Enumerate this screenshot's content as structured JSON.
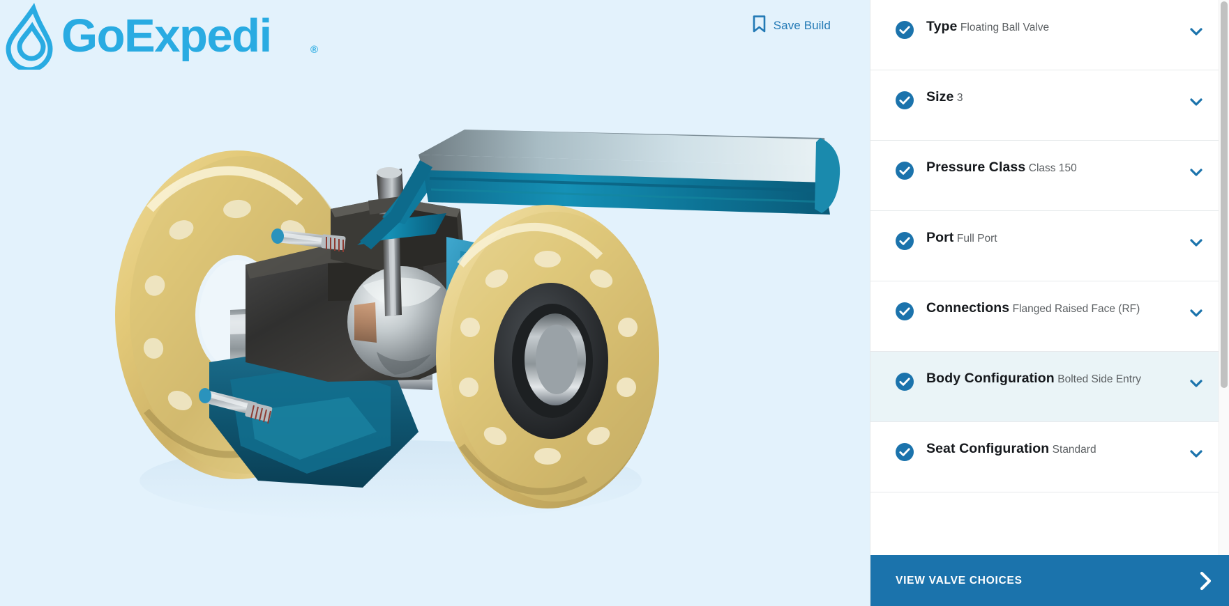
{
  "brand": {
    "name": "GoExpedi",
    "trademark": "®",
    "logo_icon": "water-drop-icon",
    "logo_color": "#29ABE2"
  },
  "header": {
    "save_build": {
      "label": "Save Build",
      "icon": "bookmark-icon",
      "color": "#2279b5"
    }
  },
  "viewer": {
    "background_color": "#e3f2fc",
    "product": "Flanged Ball Valve cutaway 3D render",
    "alt": "3D cutaway render of a floating ball valve with raised-face flanges and a blue lever handle"
  },
  "panel": {
    "accent_color": "#1b73ac",
    "selected_row_color": "#eaf4f7",
    "options": [
      {
        "title": "Type",
        "value": "Floating Ball Valve",
        "icon": "check-circle-icon",
        "chevron": "chevron-down-icon",
        "selected": false
      },
      {
        "title": "Size",
        "value": "3",
        "icon": "check-circle-icon",
        "chevron": "chevron-down-icon",
        "selected": false
      },
      {
        "title": "Pressure Class",
        "value": "Class 150",
        "icon": "check-circle-icon",
        "chevron": "chevron-down-icon",
        "selected": false
      },
      {
        "title": "Port",
        "value": "Full Port",
        "icon": "check-circle-icon",
        "chevron": "chevron-down-icon",
        "selected": false
      },
      {
        "title": "Connections",
        "value": "Flanged Raised Face (RF)",
        "icon": "check-circle-icon",
        "chevron": "chevron-down-icon",
        "selected": false
      },
      {
        "title": "Body Configuration",
        "value": "Bolted Side Entry",
        "icon": "check-circle-icon",
        "chevron": "chevron-down-icon",
        "selected": true
      },
      {
        "title": "Seat Configuration",
        "value": "Standard",
        "icon": "check-circle-icon",
        "chevron": "chevron-down-icon",
        "selected": false
      }
    ]
  },
  "cta": {
    "label": "VIEW VALVE CHOICES",
    "icon": "chevron-right-icon",
    "background_color": "#1b73ac"
  }
}
